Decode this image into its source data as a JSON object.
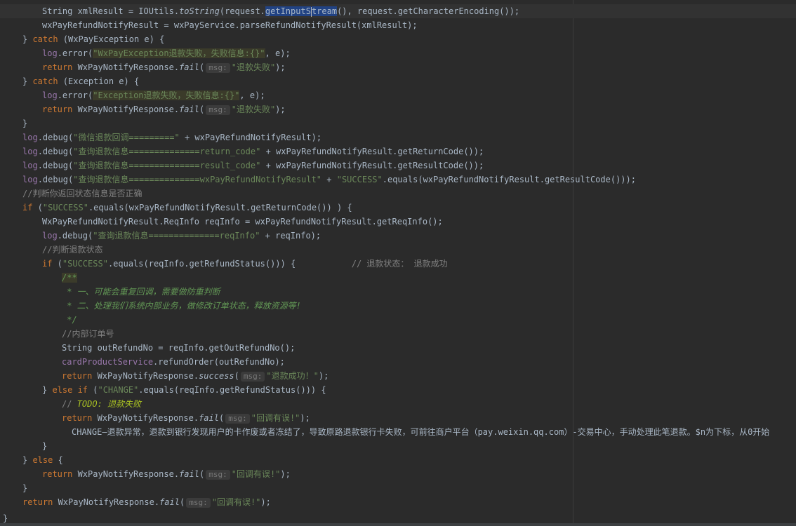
{
  "code_lines": [
    {
      "indent": 60,
      "current": true,
      "tokens": [
        {
          "t": "String xmlResult = IOUtils.",
          "c": ""
        },
        {
          "t": "toString",
          "c": "it"
        },
        {
          "t": "(request.",
          "c": ""
        },
        {
          "t": "getInputS",
          "c": "hlsel"
        },
        {
          "t": "",
          "c": "caret"
        },
        {
          "t": "tream",
          "c": "hlsel"
        },
        {
          "t": "(), request.getCharacterEncoding());",
          "c": ""
        }
      ]
    },
    {
      "indent": 60,
      "tokens": [
        {
          "t": "wxPayRefundNotifyResult = wxPayService.parseRefundNotifyResult(xmlResult);",
          "c": ""
        }
      ]
    },
    {
      "indent": 32,
      "tokens": [
        {
          "t": "} ",
          "c": ""
        },
        {
          "t": "catch",
          "c": "kw"
        },
        {
          "t": " (WxPayException e) {",
          "c": ""
        }
      ]
    },
    {
      "indent": 60,
      "tokens": [
        {
          "t": "log",
          "c": "fld"
        },
        {
          "t": ".error(",
          "c": ""
        },
        {
          "t": "\"WxPayException退款失败，失败信息:{}\"",
          "c": "str hlstr"
        },
        {
          "t": ", e);",
          "c": ""
        }
      ]
    },
    {
      "indent": 60,
      "tokens": [
        {
          "t": "return",
          "c": "kw"
        },
        {
          "t": " WxPayNotifyResponse.",
          "c": ""
        },
        {
          "t": "fail",
          "c": "it"
        },
        {
          "t": "(",
          "c": ""
        },
        {
          "t": "msg:",
          "c": "hint"
        },
        {
          "t": "\"退款失败\"",
          "c": "str"
        },
        {
          "t": ");",
          "c": ""
        }
      ]
    },
    {
      "indent": 32,
      "tokens": [
        {
          "t": "} ",
          "c": ""
        },
        {
          "t": "catch",
          "c": "kw"
        },
        {
          "t": " (Exception e) {",
          "c": ""
        }
      ]
    },
    {
      "indent": 60,
      "tokens": [
        {
          "t": "log",
          "c": "fld"
        },
        {
          "t": ".error(",
          "c": ""
        },
        {
          "t": "\"Exception退款失败，失败信息:{}\"",
          "c": "str hlstr"
        },
        {
          "t": ", e);",
          "c": ""
        }
      ]
    },
    {
      "indent": 60,
      "tokens": [
        {
          "t": "return",
          "c": "kw"
        },
        {
          "t": " WxPayNotifyResponse.",
          "c": ""
        },
        {
          "t": "fail",
          "c": "it"
        },
        {
          "t": "(",
          "c": ""
        },
        {
          "t": "msg:",
          "c": "hint"
        },
        {
          "t": "\"退款失败\"",
          "c": "str"
        },
        {
          "t": ");",
          "c": ""
        }
      ]
    },
    {
      "indent": 32,
      "tokens": [
        {
          "t": "}",
          "c": ""
        }
      ]
    },
    {
      "indent": 32,
      "tokens": [
        {
          "t": "log",
          "c": "fld"
        },
        {
          "t": ".debug(",
          "c": ""
        },
        {
          "t": "\"微信退款回调=========\"",
          "c": "str"
        },
        {
          "t": " + wxPayRefundNotifyResult);",
          "c": ""
        }
      ]
    },
    {
      "indent": 32,
      "tokens": [
        {
          "t": "log",
          "c": "fld"
        },
        {
          "t": ".debug(",
          "c": ""
        },
        {
          "t": "\"查询退款信息==============return_code\"",
          "c": "str"
        },
        {
          "t": " + wxPayRefundNotifyResult.getReturnCode());",
          "c": ""
        }
      ]
    },
    {
      "indent": 32,
      "tokens": [
        {
          "t": "log",
          "c": "fld"
        },
        {
          "t": ".debug(",
          "c": ""
        },
        {
          "t": "\"查询退款信息==============result_code\"",
          "c": "str"
        },
        {
          "t": " + wxPayRefundNotifyResult.getResultCode());",
          "c": ""
        }
      ]
    },
    {
      "indent": 32,
      "tokens": [
        {
          "t": "log",
          "c": "fld"
        },
        {
          "t": ".debug(",
          "c": ""
        },
        {
          "t": "\"查询退款信息==============wxPayRefundNotifyResult\"",
          "c": "str"
        },
        {
          "t": " + ",
          "c": ""
        },
        {
          "t": "\"SUCCESS\"",
          "c": "str"
        },
        {
          "t": ".equals(wxPayRefundNotifyResult.getResultCode()));",
          "c": ""
        }
      ]
    },
    {
      "indent": 32,
      "tokens": [
        {
          "t": "//判断你返回状态信息是否正确",
          "c": "cmt"
        }
      ]
    },
    {
      "indent": 32,
      "tokens": [
        {
          "t": "if",
          "c": "kw"
        },
        {
          "t": " (",
          "c": ""
        },
        {
          "t": "\"SUCCESS\"",
          "c": "str"
        },
        {
          "t": ".equals(wxPayRefundNotifyResult.getReturnCode()) ) {",
          "c": ""
        }
      ]
    },
    {
      "indent": 60,
      "tokens": [
        {
          "t": "WxPayRefundNotifyResult.ReqInfo reqInfo = wxPayRefundNotifyResult.getReqInfo();",
          "c": ""
        }
      ]
    },
    {
      "indent": 60,
      "tokens": [
        {
          "t": "log",
          "c": "fld"
        },
        {
          "t": ".debug(",
          "c": ""
        },
        {
          "t": "\"查询退款信息==============reqInfo\"",
          "c": "str"
        },
        {
          "t": " + reqInfo);",
          "c": ""
        }
      ]
    },
    {
      "indent": 60,
      "tokens": [
        {
          "t": "//判断退款状态",
          "c": "cmt"
        }
      ]
    },
    {
      "indent": 60,
      "tokens": [
        {
          "t": "if",
          "c": "kw"
        },
        {
          "t": " (",
          "c": ""
        },
        {
          "t": "\"SUCCESS\"",
          "c": "str"
        },
        {
          "t": ".equals(reqInfo.getRefundStatus())) {",
          "c": ""
        },
        {
          "t": "           // 退款状态： 退款成功",
          "c": "cmt"
        }
      ]
    },
    {
      "indent": 88,
      "tokens": [
        {
          "t": "/**",
          "c": "doc hlstr"
        }
      ]
    },
    {
      "indent": 88,
      "tokens": [
        {
          "t": " * 一、可能会重复回调，需要做防重判断",
          "c": "doc"
        }
      ]
    },
    {
      "indent": 88,
      "tokens": [
        {
          "t": " * 二、处理我们系统内部业务，做修改订单状态，释放资源等!",
          "c": "doc"
        }
      ]
    },
    {
      "indent": 88,
      "tokens": [
        {
          "t": " */",
          "c": "doc"
        }
      ]
    },
    {
      "indent": 88,
      "tokens": [
        {
          "t": "//内部订单号",
          "c": "cmt"
        }
      ]
    },
    {
      "indent": 88,
      "tokens": [
        {
          "t": "String outRefundNo = reqInfo.getOutRefundNo();",
          "c": ""
        }
      ]
    },
    {
      "indent": 88,
      "tokens": [
        {
          "t": "cardProductService",
          "c": "fld"
        },
        {
          "t": ".refundOrder(outRefundNo);",
          "c": ""
        }
      ]
    },
    {
      "indent": 88,
      "tokens": [
        {
          "t": "return",
          "c": "kw"
        },
        {
          "t": " WxPayNotifyResponse.",
          "c": ""
        },
        {
          "t": "success",
          "c": "it"
        },
        {
          "t": "(",
          "c": ""
        },
        {
          "t": "msg:",
          "c": "hint"
        },
        {
          "t": "\"退款成功！\"",
          "c": "str"
        },
        {
          "t": ");",
          "c": ""
        }
      ]
    },
    {
      "indent": 60,
      "tokens": [
        {
          "t": "} ",
          "c": ""
        },
        {
          "t": "else if",
          "c": "kw"
        },
        {
          "t": " (",
          "c": ""
        },
        {
          "t": "\"CHANGE\"",
          "c": "str"
        },
        {
          "t": ".equals(reqInfo.getRefundStatus())) {",
          "c": ""
        }
      ]
    },
    {
      "indent": 88,
      "tokens": [
        {
          "t": "// ",
          "c": "cmt"
        },
        {
          "t": "TODO: 退款失败",
          "c": "todo"
        }
      ]
    },
    {
      "indent": 88,
      "tokens": [
        {
          "t": "return",
          "c": "kw"
        },
        {
          "t": " WxPayNotifyResponse.",
          "c": ""
        },
        {
          "t": "fail",
          "c": "it"
        },
        {
          "t": "(",
          "c": ""
        },
        {
          "t": "msg:",
          "c": "hint"
        },
        {
          "t": "\"回调有误!\"",
          "c": "str"
        },
        {
          "t": ");",
          "c": ""
        }
      ]
    },
    {
      "indent": 102,
      "tokens": [
        {
          "t": "CHANGE—退款异常，退款到银行发现用户的卡作废或者冻结了，导致原路退款银行卡失败，可前往商户平台（pay.weixin.qq.com）-交易中心，手动处理此笔退款。$n为下标，从0开始",
          "c": ""
        }
      ]
    },
    {
      "indent": 60,
      "tokens": [
        {
          "t": "}",
          "c": ""
        }
      ]
    },
    {
      "indent": 32,
      "tokens": [
        {
          "t": "} ",
          "c": ""
        },
        {
          "t": "else",
          "c": "kw"
        },
        {
          "t": " {",
          "c": ""
        }
      ]
    },
    {
      "indent": 60,
      "tokens": [
        {
          "t": "return",
          "c": "kw"
        },
        {
          "t": " WxPayNotifyResponse.",
          "c": ""
        },
        {
          "t": "fail",
          "c": "it"
        },
        {
          "t": "(",
          "c": ""
        },
        {
          "t": "msg:",
          "c": "hint"
        },
        {
          "t": "\"回调有误!\"",
          "c": "str"
        },
        {
          "t": ");",
          "c": ""
        }
      ]
    },
    {
      "indent": 32,
      "tokens": [
        {
          "t": "}",
          "c": ""
        }
      ]
    },
    {
      "indent": 32,
      "tokens": [
        {
          "t": "return",
          "c": "kw"
        },
        {
          "t": " WxPayNotifyResponse.",
          "c": ""
        },
        {
          "t": "fail",
          "c": "it"
        },
        {
          "t": "(",
          "c": ""
        },
        {
          "t": "msg:",
          "c": "hint"
        },
        {
          "t": "\"回调有误!\"",
          "c": "str"
        },
        {
          "t": ");",
          "c": ""
        }
      ]
    }
  ],
  "closing_brace": "}",
  "colors": {
    "background": "#2b2b2b",
    "keyword": "#cc7832",
    "string": "#6a8759",
    "field": "#9876aa",
    "comment": "#808080",
    "doc_comment": "#629755",
    "todo": "#a8c023",
    "selection": "#214283"
  }
}
